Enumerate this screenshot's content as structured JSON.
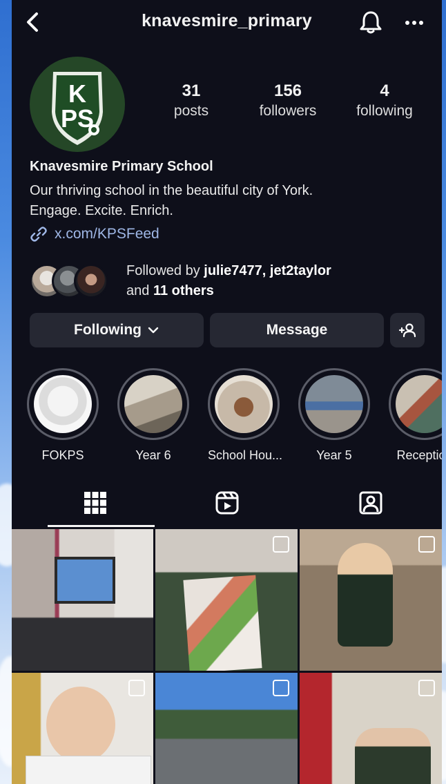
{
  "header": {
    "username": "knavesmire_primary",
    "back_icon": "chevron-left-icon",
    "bell_icon": "bell-icon",
    "more_icon": "more-horizontal-icon"
  },
  "profile": {
    "avatar_text": [
      "K",
      "PS"
    ],
    "stats": [
      {
        "value": "31",
        "label": "posts"
      },
      {
        "value": "156",
        "label": "followers"
      },
      {
        "value": "4",
        "label": "following"
      }
    ],
    "name": "Knavesmire Primary School",
    "bio_line1": "Our thriving school in the beautiful city of York.",
    "bio_line2": "Engage. Excite. Enrich.",
    "link": "x.com/KPSFeed",
    "followed_prefix": "Followed by ",
    "followed_users": "julie7477, jet2taylor",
    "followed_and": "and ",
    "followed_others": "11 others"
  },
  "actions": {
    "following_label": "Following",
    "message_label": "Message",
    "add_user_icon": "add-person-icon"
  },
  "highlights": [
    {
      "label": "FOKPS"
    },
    {
      "label": "Year 6"
    },
    {
      "label": "School Hou..."
    },
    {
      "label": "Year 5"
    },
    {
      "label": "Reception"
    }
  ],
  "tabs": [
    {
      "icon": "grid-icon",
      "active": true
    },
    {
      "icon": "reels-icon",
      "active": false
    },
    {
      "icon": "tagged-icon",
      "active": false
    }
  ],
  "colors": {
    "background": "#0e0f1a",
    "button": "#262833",
    "link": "#9fb7e6",
    "avatar_green": "#254727"
  }
}
